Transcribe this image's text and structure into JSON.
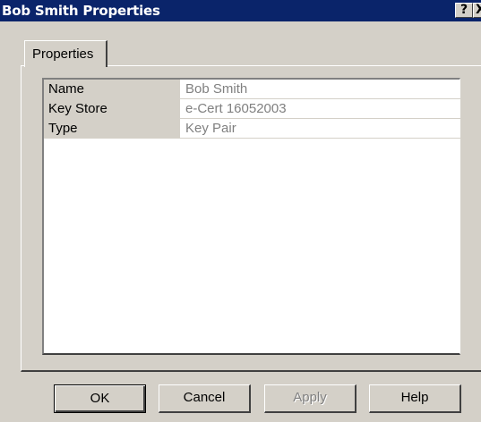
{
  "window": {
    "title": "Bob Smith Properties",
    "help_glyph": "?",
    "close_glyph": "X"
  },
  "tabs": [
    {
      "label": "Properties",
      "selected": true
    }
  ],
  "properties": [
    {
      "key": "Name",
      "value": "Bob Smith"
    },
    {
      "key": "Key Store",
      "value": "e-Cert 16052003"
    },
    {
      "key": "Type",
      "value": "Key Pair"
    }
  ],
  "buttons": {
    "ok": "OK",
    "cancel": "Cancel",
    "apply": "Apply",
    "help": "Help"
  },
  "colors": {
    "titlebar": "#0a246a",
    "face": "#d4d0c8",
    "value_text": "#808080"
  }
}
